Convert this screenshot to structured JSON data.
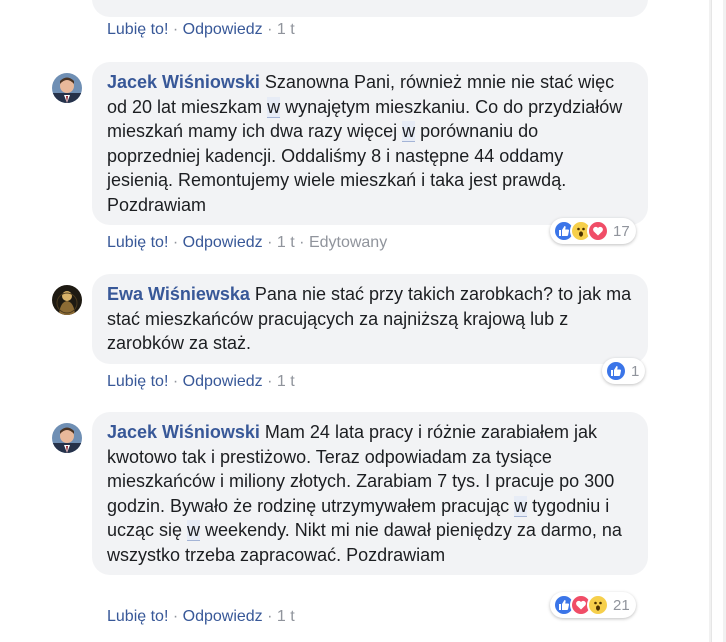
{
  "actions": {
    "like_label": "Lubię to!",
    "reply_label": "Odpowiedz",
    "separator": "·",
    "edited_label": "Edytowany"
  },
  "comments": [
    {
      "time": "1 t",
      "edited": false
    },
    {
      "author": "Jacek Wiśniowski",
      "text_1": " Szanowna Pani, również mnie nie stać więc od 20 lat mieszkam ",
      "w_1": "w",
      "text_2": " wynajętym mieszkaniu. Co do przydziałów mieszkań mamy ich dwa razy więcej ",
      "w_2": "w",
      "text_3": " porównaniu do poprzedniej kadencji. Oddaliśmy 8 i następne 44 oddamy jesienią. Remontujemy wiele mieszkań i taka jest prawdą. Pozdrawiam",
      "time": "1 t",
      "edited": true,
      "reactions": [
        "like",
        "wow",
        "love"
      ],
      "reaction_count": "17"
    },
    {
      "author": "Ewa Wiśniewska",
      "text_1": " Pana nie stać przy takich zarobkach? to jak ma stać mieszkańców pracujących za najniższą krajową lub z zarobków za staż.",
      "time": "1 t",
      "edited": false,
      "reactions": [
        "like"
      ],
      "reaction_count": "1"
    },
    {
      "author": "Jacek Wiśniowski",
      "text_1": " Mam 24 lata pracy i różnie zarabiałem jak kwotowo tak i prestiżowo. Teraz odpowiadam za tysiące mieszkańców i miliony złotych. Zarabiam 7 tys. I pracuje po 300 godzin. Bywało że rodzinę utrzymywałem pracując ",
      "w_1": "w",
      "text_2": " tygodniu i ucząc się ",
      "w_2": "w",
      "text_3": " weekendy. Nikt mi nie dawał pieniędzy za darmo, na wszystko trzeba zapracować. Pozdrawiam",
      "time": "1 t",
      "edited": false,
      "reactions": [
        "like",
        "love",
        "wow"
      ],
      "reaction_count": "21"
    }
  ]
}
